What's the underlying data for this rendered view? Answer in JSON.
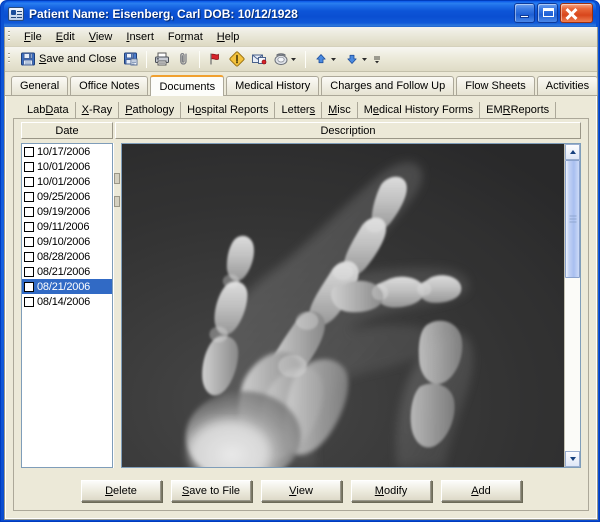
{
  "window": {
    "title": "Patient Name: Eisenberg, Carl DOB: 10/12/1928",
    "icon": "patient-card-icon",
    "controls": {
      "minimize": "Minimize",
      "maximize": "Maximize",
      "close": "Close"
    }
  },
  "menu": {
    "items": [
      {
        "label": "File",
        "pre": "",
        "key": "F",
        "post": "ile"
      },
      {
        "label": "Edit",
        "pre": "",
        "key": "E",
        "post": "dit"
      },
      {
        "label": "View",
        "pre": "",
        "key": "V",
        "post": "iew"
      },
      {
        "label": "Insert",
        "pre": "",
        "key": "I",
        "post": "nsert"
      },
      {
        "label": "Format",
        "pre": "Fo",
        "key": "r",
        "post": "mat"
      },
      {
        "label": "Help",
        "pre": "",
        "key": "H",
        "post": "elp"
      }
    ]
  },
  "toolbar": {
    "save_and_close": "Save and Close",
    "save_and_close_key": "S",
    "save_and_close_rest": "ave and Close",
    "icons": [
      "save-icon",
      "save-as-icon",
      "print-icon",
      "attachment-icon",
      "flag-icon",
      "importance-icon",
      "mail-icon",
      "phone-icon",
      "previous-item-icon",
      "next-item-icon"
    ]
  },
  "tabs": {
    "active": "Documents",
    "items": [
      {
        "label": "General"
      },
      {
        "label": "Office Notes"
      },
      {
        "label": "Documents"
      },
      {
        "label": "Medical History"
      },
      {
        "label": "Charges and Follow Up"
      },
      {
        "label": "Flow Sheets"
      },
      {
        "label": "Activities"
      }
    ]
  },
  "subtabs": {
    "active": "X-Ray",
    "items": [
      {
        "label": "Lab Data",
        "pre": "Lab ",
        "key": "D",
        "post": "ata"
      },
      {
        "label": "X-Ray",
        "pre": "",
        "key": "X",
        "post": "-Ray"
      },
      {
        "label": "Pathology",
        "pre": "",
        "key": "P",
        "post": "athology"
      },
      {
        "label": "Hospital Reports",
        "pre": "H",
        "key": "o",
        "post": "spital Reports"
      },
      {
        "label": "Letters",
        "pre": "Letter",
        "key": "s",
        "post": ""
      },
      {
        "label": "Misc",
        "pre": "",
        "key": "M",
        "post": "isc"
      },
      {
        "label": "Medical History Forms",
        "pre": "M",
        "key": "e",
        "post": "dical History Forms"
      },
      {
        "label": "EMR Reports",
        "pre": "EM",
        "key": "R",
        "post": " Reports"
      }
    ]
  },
  "columns": {
    "date": "Date",
    "description": "Description"
  },
  "documents": {
    "selected_index": 9,
    "rows": [
      {
        "date": "10/17/2006",
        "checked": false
      },
      {
        "date": "10/01/2006",
        "checked": false
      },
      {
        "date": "10/01/2006",
        "checked": false
      },
      {
        "date": "09/25/2006",
        "checked": false
      },
      {
        "date": "09/19/2006",
        "checked": false
      },
      {
        "date": "09/11/2006",
        "checked": false
      },
      {
        "date": "09/10/2006",
        "checked": false
      },
      {
        "date": "08/28/2006",
        "checked": false
      },
      {
        "date": "08/21/2006",
        "checked": false
      },
      {
        "date": "08/21/2006",
        "checked": false
      },
      {
        "date": "08/14/2006",
        "checked": false
      }
    ]
  },
  "preview": {
    "type": "x-ray-image",
    "subject": "hand radiograph",
    "background_color": "#333334"
  },
  "scrollbar": {
    "up_arrow": "scroll-up-icon",
    "down_arrow": "scroll-down-icon"
  },
  "actions": {
    "buttons": [
      {
        "label": "Delete",
        "pre": "",
        "key": "D",
        "post": "elete"
      },
      {
        "label": "Save to File",
        "pre": "",
        "key": "S",
        "post": "ave to File"
      },
      {
        "label": "View",
        "pre": "",
        "key": "V",
        "post": "iew"
      },
      {
        "label": "Modify",
        "pre": "",
        "key": "M",
        "post": "odify"
      },
      {
        "label": "Add",
        "pre": "",
        "key": "A",
        "post": "dd"
      }
    ]
  },
  "colors": {
    "titlebar_blue": "#1560e0",
    "accent_orange": "#f0a030",
    "selection_blue": "#316ac5",
    "panel_beige": "#ece9d8"
  }
}
